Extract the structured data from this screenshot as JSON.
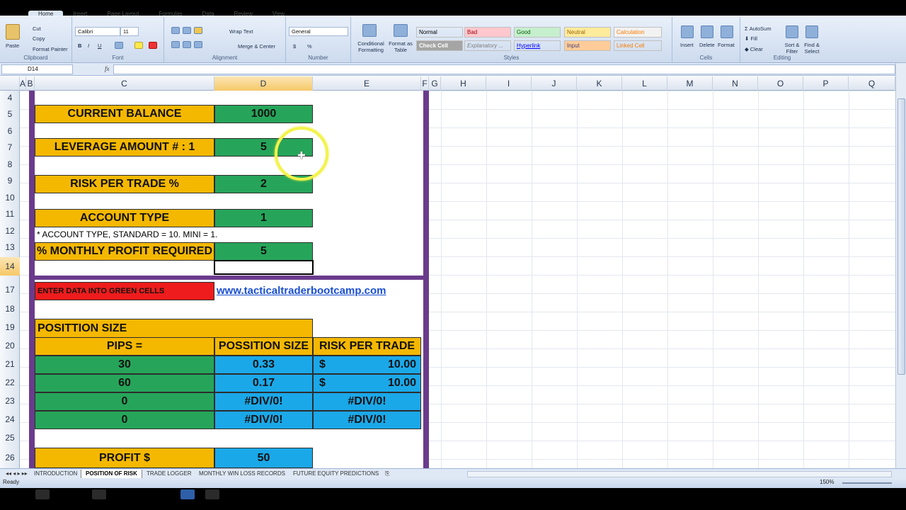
{
  "ribbon": {
    "tabs": [
      "Home",
      "Insert",
      "Page Layout",
      "Formulas",
      "Data",
      "Review",
      "View"
    ],
    "clipboard": {
      "paste": "Paste",
      "cut": "Cut",
      "copy": "Copy",
      "format_painter": "Format Painter",
      "label": "Clipboard"
    },
    "font": {
      "name": "Calibri",
      "size": "11",
      "label": "Font",
      "bold": "B",
      "italic": "I",
      "underline": "U"
    },
    "alignment": {
      "wrap": "Wrap Text",
      "merge": "Merge & Center",
      "label": "Alignment"
    },
    "number": {
      "format": "General",
      "label": "Number",
      "currency": "$",
      "percent": "%"
    },
    "styles": {
      "conditional": "Conditional Formatting",
      "format_table": "Format as Table",
      "label": "Styles",
      "cells": [
        {
          "name": "Normal",
          "bg": "#ffffff",
          "fg": "#000000"
        },
        {
          "name": "Bad",
          "bg": "#ffc7ce",
          "fg": "#9c0006"
        },
        {
          "name": "Good",
          "bg": "#c6efce",
          "fg": "#006100"
        },
        {
          "name": "Neutral",
          "bg": "#ffeb9c",
          "fg": "#9c6500"
        },
        {
          "name": "Calculation",
          "bg": "#f2f2f2",
          "fg": "#fa7d00"
        },
        {
          "name": "Check Cell",
          "bg": "#a5a5a5",
          "fg": "#ffffff"
        },
        {
          "name": "Explanatory ...",
          "bg": "#ffffff",
          "fg": "#7f7f7f"
        },
        {
          "name": "Hyperlink",
          "bg": "#ffffff",
          "fg": "#0000ff"
        },
        {
          "name": "Input",
          "bg": "#ffcc99",
          "fg": "#3f3f76"
        },
        {
          "name": "Linked Cell",
          "bg": "#ffffff",
          "fg": "#fa7d00"
        }
      ]
    },
    "cells_group": {
      "insert": "Insert",
      "delete": "Delete",
      "format": "Format",
      "label": "Cells"
    },
    "editing": {
      "autosum": "AutoSum",
      "fill": "Fill",
      "clear": "Clear",
      "sort": "Sort & Filter",
      "find": "Find & Select",
      "label": "Editing"
    }
  },
  "formula_bar": {
    "name_box": "D14",
    "fx": "fx",
    "value": ""
  },
  "columns": [
    "A",
    "B",
    "C",
    "D",
    "E",
    "F",
    "G",
    "H",
    "I",
    "J",
    "K",
    "L",
    "M",
    "N",
    "O",
    "P",
    "Q"
  ],
  "selected_column": "D",
  "rows": [
    "4",
    "5",
    "6",
    "7",
    "8",
    "9",
    "10",
    "11",
    "12",
    "13",
    "14",
    "17",
    "18",
    "19",
    "20",
    "21",
    "22",
    "23",
    "24",
    "25",
    "26"
  ],
  "selected_row": "14",
  "sheet": {
    "current_balance_label": "CURRENT BALANCE",
    "current_balance_value": "1000",
    "leverage_label": "LEVERAGE AMOUNT  # : 1",
    "leverage_value": "5",
    "risk_label": "RISK PER TRADE %",
    "risk_value": "2",
    "account_type_label": "ACCOUNT TYPE",
    "account_type_value": "1",
    "account_note": "* ACCOUNT TYPE, STANDARD = 10. MINI = 1.",
    "monthly_profit_label": "% MONTHLY PROFIT REQUIRED",
    "monthly_profit_value": "5",
    "enter_data": "ENTER DATA INTO GREEN CELLS",
    "website": "www.tacticaltraderbootcamp.com",
    "position_size_header": "POSITTION SIZE",
    "table_headers": [
      "PIPS =",
      "POSSITION SIZE",
      "RISK PER TRADE"
    ],
    "table_rows": [
      {
        "pips": "30",
        "size": "0.33",
        "currency": "$",
        "risk": "10.00"
      },
      {
        "pips": "60",
        "size": "0.17",
        "currency": "$",
        "risk": "10.00"
      },
      {
        "pips": "0",
        "size": "#DIV/0!",
        "currency": "",
        "risk": "#DIV/0!"
      },
      {
        "pips": "0",
        "size": "#DIV/0!",
        "currency": "",
        "risk": "#DIV/0!"
      }
    ],
    "profit_label": "PROFIT $",
    "profit_value": "50"
  },
  "sheet_tabs": [
    "INTRODUCTION",
    "POSITION OF RISK",
    "TRADE LOGGER",
    "MONTHLY WIN LOSS RECORDS",
    "FUTURE EQUITY PREDICTIONS"
  ],
  "active_sheet": "POSITION OF RISK",
  "status": {
    "text": "Ready",
    "zoom": "150%"
  }
}
